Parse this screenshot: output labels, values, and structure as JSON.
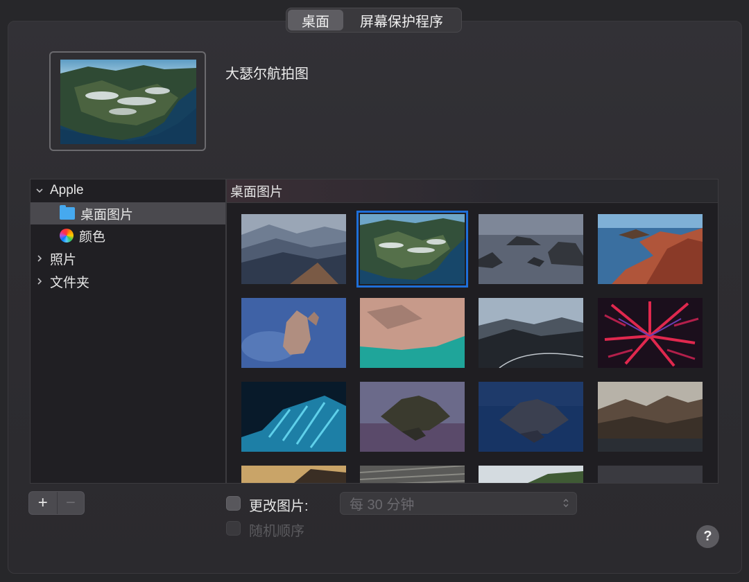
{
  "tabs": [
    {
      "label": "桌面",
      "active": true
    },
    {
      "label": "屏幕保护程序",
      "active": false
    }
  ],
  "current_wallpaper": {
    "name": "大瑟尔航拍图"
  },
  "sidebar": {
    "items": [
      {
        "label": "Apple",
        "icon": "chevron-down-icon",
        "expanded": true
      },
      {
        "label": "桌面图片",
        "icon": "folder-icon",
        "selected": true
      },
      {
        "label": "颜色",
        "icon": "color-wheel-icon"
      },
      {
        "label": "照片",
        "icon": "chevron-right-icon"
      },
      {
        "label": "文件夹",
        "icon": "chevron-right-icon"
      }
    ]
  },
  "content": {
    "header": "桌面图片",
    "selected_index": 1,
    "thumbnail_count": 16
  },
  "controls": {
    "add_label": "+",
    "remove_label": "−",
    "change_picture_label": "更改图片:",
    "change_interval_value": "每 30 分钟",
    "random_order_label": "随机顺序",
    "help_label": "?"
  },
  "colors": {
    "accent": "#1e6fd9",
    "folder": "#46a9ef"
  }
}
